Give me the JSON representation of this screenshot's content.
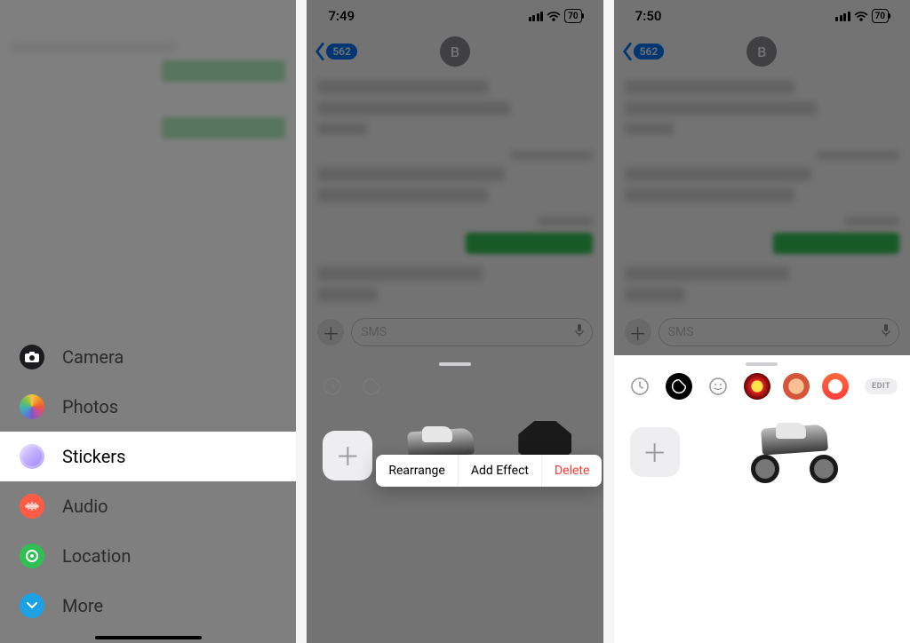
{
  "panel1": {
    "sheet": {
      "camera": "Camera",
      "photos": "Photos",
      "stickers": "Stickers",
      "audio": "Audio",
      "location": "Location",
      "more": "More"
    }
  },
  "panel2": {
    "time": "7:49",
    "battery": "70",
    "back_badge": "562",
    "avatar_letter": "B",
    "compose_placeholder": "SMS",
    "ctx": {
      "rearrange": "Rearrange",
      "addeffect": "Add Effect",
      "delete": "Delete"
    }
  },
  "panel3": {
    "time": "7:50",
    "battery": "70",
    "back_badge": "562",
    "avatar_letter": "B",
    "compose_placeholder": "SMS",
    "edit_label": "EDIT"
  }
}
